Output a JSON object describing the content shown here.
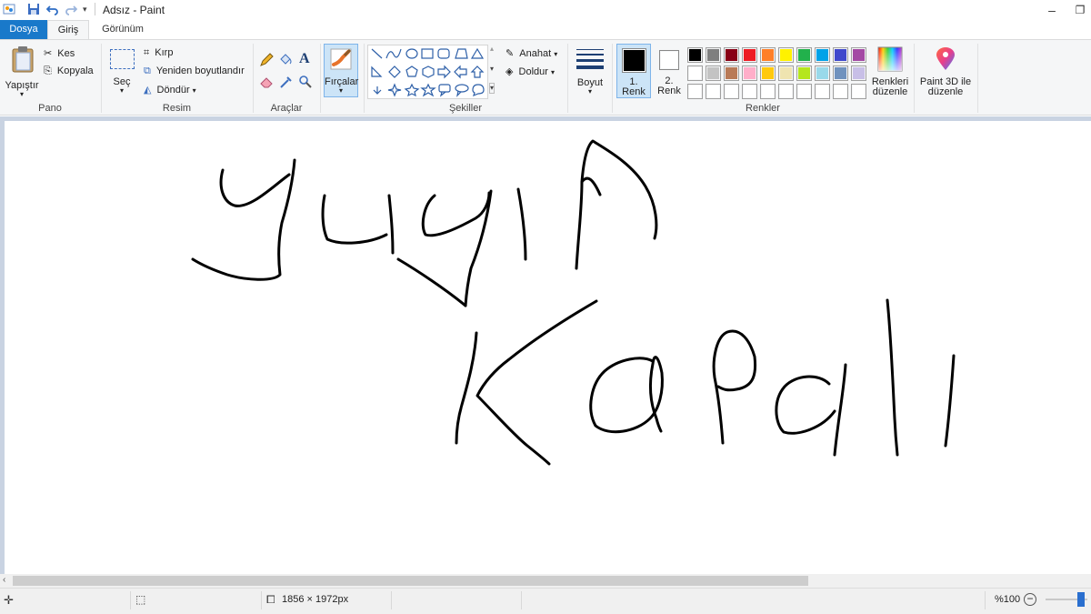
{
  "window": {
    "title": "Adsız - Paint"
  },
  "tabs": [
    {
      "label": "Dosya"
    },
    {
      "label": "Giriş"
    },
    {
      "label": "Görünüm"
    }
  ],
  "ribbon": {
    "clipboard": {
      "paste_label": "Yapıştır",
      "cut_label": "Kes",
      "copy_label": "Kopyala",
      "group_label": "Pano"
    },
    "image": {
      "select_label": "Seç",
      "crop_label": "Kırp",
      "resize_label": "Yeniden boyutlandır",
      "rotate_label": "Döndür",
      "group_label": "Resim"
    },
    "tools": {
      "group_label": "Araçlar"
    },
    "brushes": {
      "label": "Fırçalar"
    },
    "shapes": {
      "outline_label": "Anahat",
      "fill_label": "Doldur",
      "group_label": "Şekiller"
    },
    "size": {
      "label": "Boyut"
    },
    "colors": {
      "color1_label_a": "1.",
      "color1_label_b": "Renk",
      "color2_label_a": "2.",
      "color2_label_b": "Renk",
      "edit_colors_a": "Renkleri",
      "edit_colors_b": "düzenle",
      "group_label": "Renkler",
      "color1": "#000000",
      "color2": "#ffffff",
      "palette_row1": [
        "#000000",
        "#7f7f7f",
        "#880015",
        "#ed1c24",
        "#ff7f27",
        "#fff200",
        "#22b14c",
        "#00a2e8",
        "#3f48cc",
        "#a349a4"
      ],
      "palette_row2": [
        "#ffffff",
        "#c3c3c3",
        "#b97a57",
        "#ffaec9",
        "#ffc90e",
        "#efe4b0",
        "#b5e61d",
        "#99d9ea",
        "#7092be",
        "#c8bfe7"
      ],
      "palette_row3": [
        "#ffffff",
        "#ffffff",
        "#ffffff",
        "#ffffff",
        "#ffffff",
        "#ffffff",
        "#ffffff",
        "#ffffff",
        "#ffffff",
        "#ffffff"
      ]
    },
    "paint3d": {
      "label_a": "Paint 3D ile",
      "label_b": "düzenle"
    }
  },
  "canvas": {
    "drawing_description_icon": "handwritten-strokes"
  },
  "statusbar": {
    "image_size": "1856 × 1972px",
    "zoom": "%100"
  }
}
